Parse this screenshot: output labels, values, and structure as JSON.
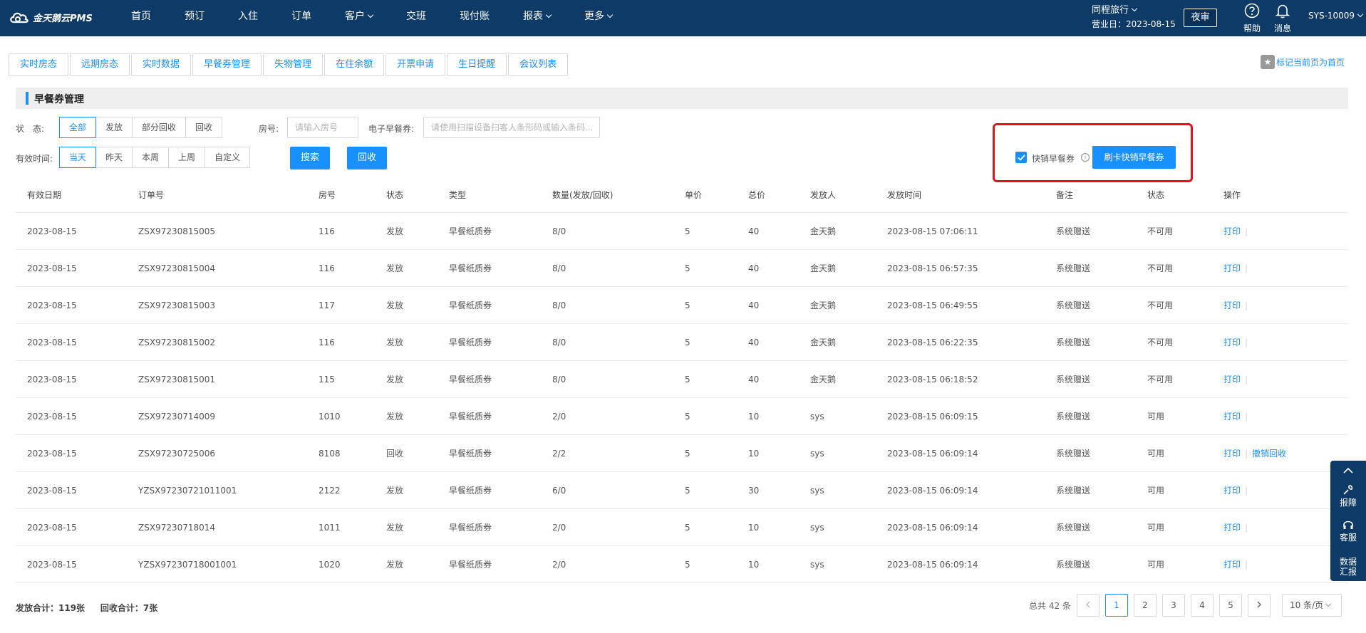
{
  "app": {
    "logo": "金天鹅云PMS"
  },
  "nav": [
    "首页",
    "预订",
    "入住",
    "订单",
    "客户",
    "交班",
    "现付账",
    "报表",
    "更多"
  ],
  "header": {
    "hotel": "同程旅行",
    "business_date": "营业日：2023-08-15",
    "night_audit": "夜审",
    "help": "帮助",
    "messages": "消息",
    "user": "SYS-10009"
  },
  "tabs": [
    "实时房态",
    "远期房态",
    "实时数据",
    "早餐券管理",
    "失物管理",
    "在住余额",
    "开票申请",
    "生日提醒",
    "会议列表"
  ],
  "mark_home": "标记当前页为首页",
  "section_title": "早餐券管理",
  "filters": {
    "status_label": "状　态:",
    "status_options": [
      "全部",
      "发放",
      "部分回收",
      "回收"
    ],
    "status_selected": "全部",
    "room_label": "房号:",
    "room_placeholder": "请输入房号",
    "evoucher_label": "电子早餐券:",
    "evoucher_placeholder": "请使用扫描设备扫客人条形码或输入条码...",
    "valid_label": "有效时间:",
    "valid_options": [
      "当天",
      "昨天",
      "本周",
      "上周",
      "自定义"
    ],
    "valid_selected": "当天",
    "search": "搜索",
    "recycle": "回收",
    "quick_checkbox": "快销早餐券",
    "quick_checked": true,
    "quick_button": "刷卡快销早餐券"
  },
  "table": {
    "headers": [
      "有效日期",
      "订单号",
      "房号",
      "状态",
      "类型",
      "数量(发放/回收)",
      "单价",
      "总价",
      "发放人",
      "发放时间",
      "备注",
      "状态",
      "操作"
    ],
    "rows": [
      [
        "2023-08-15",
        "ZSX97230815005",
        "116",
        "发放",
        "早餐纸质券",
        "8/0",
        "5",
        "40",
        "金天鹅",
        "2023-08-15 07:06:11",
        "系统赠送",
        "不可用",
        "打印",
        ""
      ],
      [
        "2023-08-15",
        "ZSX97230815004",
        "116",
        "发放",
        "早餐纸质券",
        "8/0",
        "5",
        "40",
        "金天鹅",
        "2023-08-15 06:57:35",
        "系统赠送",
        "不可用",
        "打印",
        ""
      ],
      [
        "2023-08-15",
        "ZSX97230815003",
        "117",
        "发放",
        "早餐纸质券",
        "8/0",
        "5",
        "40",
        "金天鹅",
        "2023-08-15 06:49:55",
        "系统赠送",
        "不可用",
        "打印",
        ""
      ],
      [
        "2023-08-15",
        "ZSX97230815002",
        "116",
        "发放",
        "早餐纸质券",
        "8/0",
        "5",
        "40",
        "金天鹅",
        "2023-08-15 06:22:35",
        "系统赠送",
        "不可用",
        "打印",
        ""
      ],
      [
        "2023-08-15",
        "ZSX97230815001",
        "115",
        "发放",
        "早餐纸质券",
        "8/0",
        "5",
        "40",
        "金天鹅",
        "2023-08-15 06:18:52",
        "系统赠送",
        "不可用",
        "打印",
        ""
      ],
      [
        "2023-08-15",
        "ZSX97230714009",
        "1010",
        "发放",
        "早餐纸质券",
        "2/0",
        "5",
        "10",
        "sys",
        "2023-08-15 06:09:15",
        "系统赠送",
        "可用",
        "打印",
        ""
      ],
      [
        "2023-08-15",
        "ZSX97230725006",
        "8108",
        "回收",
        "早餐纸质券",
        "2/2",
        "5",
        "10",
        "sys",
        "2023-08-15 06:09:14",
        "系统赠送",
        "可用",
        "打印",
        "撤销回收"
      ],
      [
        "2023-08-15",
        "YZSX97230721011001",
        "2122",
        "发放",
        "早餐纸质券",
        "6/0",
        "5",
        "30",
        "sys",
        "2023-08-15 06:09:14",
        "系统赠送",
        "可用",
        "打印",
        ""
      ],
      [
        "2023-08-15",
        "ZSX97230718014",
        "1011",
        "发放",
        "早餐纸质券",
        "2/0",
        "5",
        "10",
        "sys",
        "2023-08-15 06:09:14",
        "系统赠送",
        "可用",
        "打印",
        ""
      ],
      [
        "2023-08-15",
        "YZSX97230718001001",
        "1020",
        "发放",
        "早餐纸质券",
        "2/0",
        "5",
        "10",
        "sys",
        "2023-08-15 06:09:14",
        "系统赠送",
        "可用",
        "打印",
        ""
      ]
    ]
  },
  "footer": {
    "issued_total": "发放合计：119张",
    "recycled_total": "回收合计：7张",
    "total": "总共 42 条",
    "pages": [
      "1",
      "2",
      "3",
      "4",
      "5"
    ],
    "current_page": "1",
    "page_size": "10 条/页"
  },
  "side_panel": {
    "report": "报障",
    "service": "客服",
    "data_report": "数据汇报"
  },
  "colors": {
    "nav_bg": "#0d3a66",
    "accent": "#1890ff",
    "highlight": "#e8111b"
  }
}
